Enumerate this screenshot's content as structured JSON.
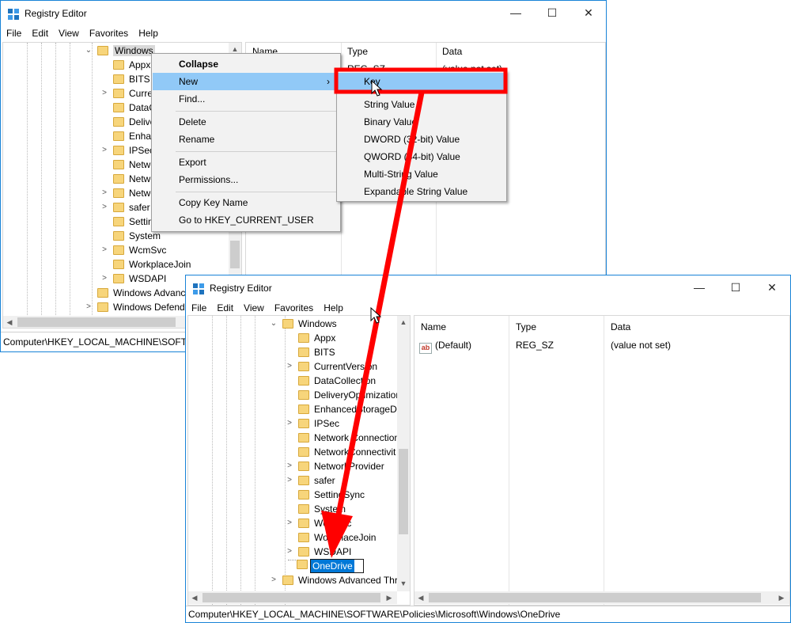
{
  "windowA": {
    "title": "Registry Editor",
    "menu": [
      "File",
      "Edit",
      "View",
      "Favorites",
      "Help"
    ],
    "tree": [
      {
        "label": "Windows",
        "chevron": "⌄"
      },
      {
        "label": "Appx",
        "chevron": ""
      },
      {
        "label": "BITS",
        "chevron": ""
      },
      {
        "label": "Curre",
        "chevron": ">"
      },
      {
        "label": "DataC",
        "chevron": ""
      },
      {
        "label": "Delive",
        "chevron": ""
      },
      {
        "label": "Enhar",
        "chevron": ""
      },
      {
        "label": "IPSec",
        "chevron": ">"
      },
      {
        "label": "Netwo",
        "chevron": ""
      },
      {
        "label": "Netwo",
        "chevron": ""
      },
      {
        "label": "Netwo",
        "chevron": ">"
      },
      {
        "label": "safer",
        "chevron": ">"
      },
      {
        "label": "Settin",
        "chevron": ""
      },
      {
        "label": "System",
        "chevron": ""
      },
      {
        "label": "WcmSvc",
        "chevron": ">"
      },
      {
        "label": "WorkplaceJoin",
        "chevron": ""
      },
      {
        "label": "WSDAPI",
        "chevron": ">"
      },
      {
        "label": "Windows Advanc",
        "chevron": ""
      },
      {
        "label": "Windows Defende",
        "chevron": ">"
      }
    ],
    "columns": {
      "name": "Name",
      "type": "Type",
      "data": "Data"
    },
    "partial_row": {
      "type": "REG_SZ",
      "data": "(value not set)"
    },
    "status": "Computer\\HKEY_LOCAL_MACHINE\\SOFTW"
  },
  "context_menu": {
    "items": [
      "Collapse",
      "New",
      "Find...",
      "Delete",
      "Rename",
      "Export",
      "Permissions...",
      "Copy Key Name",
      "Go to HKEY_CURRENT_USER"
    ],
    "submenu_arrow": "›"
  },
  "submenu": {
    "items": [
      "Key",
      "String Value",
      "Binary Value",
      "DWORD (32-bit) Value",
      "QWORD (64-bit) Value",
      "Multi-String Value",
      "Expandable String Value"
    ]
  },
  "windowB": {
    "title": "Registry Editor",
    "menu": [
      "File",
      "Edit",
      "View",
      "Favorites",
      "Help"
    ],
    "tree": [
      {
        "label": "Windows",
        "chevron": "⌄"
      },
      {
        "label": "Appx",
        "chevron": ""
      },
      {
        "label": "BITS",
        "chevron": ""
      },
      {
        "label": "CurrentVersion",
        "chevron": ">"
      },
      {
        "label": "DataCollection",
        "chevron": ""
      },
      {
        "label": "DeliveryOptimization",
        "chevron": ""
      },
      {
        "label": "EnhancedStorageDe",
        "chevron": ""
      },
      {
        "label": "IPSec",
        "chevron": ">"
      },
      {
        "label": "Network Connection",
        "chevron": ""
      },
      {
        "label": "NetworkConnectivit",
        "chevron": ""
      },
      {
        "label": "NetworkProvider",
        "chevron": ">"
      },
      {
        "label": "safer",
        "chevron": ">"
      },
      {
        "label": "SettingSync",
        "chevron": ""
      },
      {
        "label": "System",
        "chevron": ""
      },
      {
        "label": "WcmSvc",
        "chevron": ">"
      },
      {
        "label": "WorkplaceJoin",
        "chevron": ""
      },
      {
        "label": "WSDAPI",
        "chevron": ">"
      }
    ],
    "new_key": "OneDrive",
    "tree_after": {
      "label": "Windows Advanced Thr",
      "chevron": ">"
    },
    "columns": {
      "name": "Name",
      "type": "Type",
      "data": "Data"
    },
    "values": [
      {
        "name": "(Default)",
        "type": "REG_SZ",
        "data": "(value not set)",
        "icon": "ab"
      }
    ],
    "status": "Computer\\HKEY_LOCAL_MACHINE\\SOFTWARE\\Policies\\Microsoft\\Windows\\OneDrive"
  },
  "caption_glyphs": {
    "minimize": "—",
    "maximize": "☐",
    "close": "✕"
  },
  "annotation": {
    "highlight_color": "#ff0000",
    "arrow_color": "#ff0000"
  }
}
